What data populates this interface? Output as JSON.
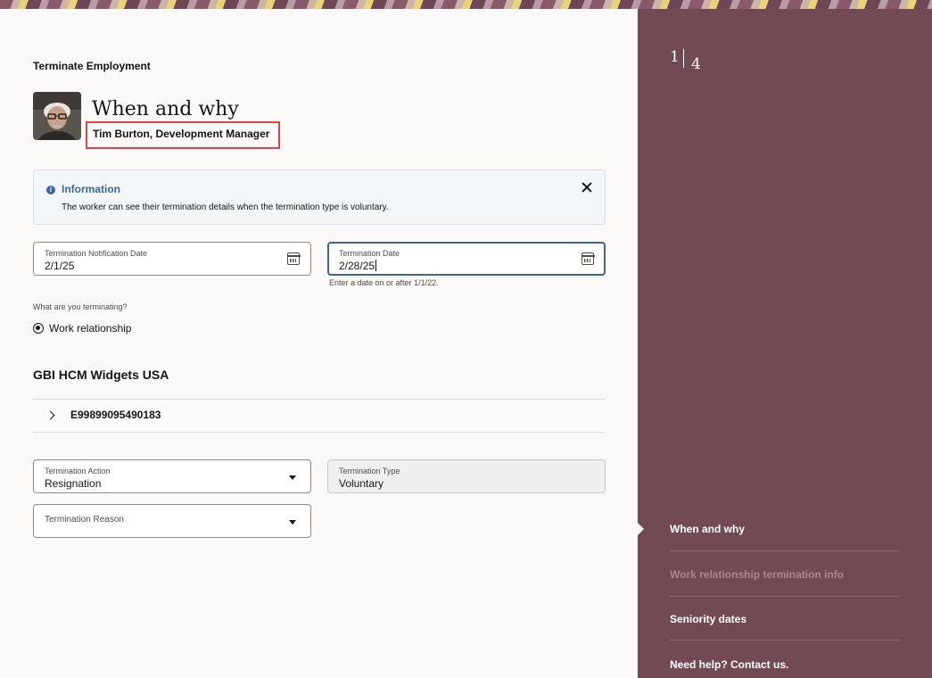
{
  "header": {
    "title": "Terminate Employment",
    "step_heading": "When and why",
    "person": "Tim Burton, Development Manager"
  },
  "info_message": {
    "title": "Information",
    "text": "The worker can see their termination details when the termination type is voluntary."
  },
  "dates": {
    "notification_label": "Termination Notification Date",
    "notification_value": "2/1/25",
    "termination_label": "Termination Date",
    "termination_value": "2/28/25",
    "termination_hint": "Enter a date on or after 1/1/22."
  },
  "terminating": {
    "question": "What are you terminating?",
    "selected_option": "Work relationship"
  },
  "legal_employer": {
    "name": "GBI HCM Widgets USA",
    "assignment_number": "E99899095490183"
  },
  "termination": {
    "action_label": "Termination Action",
    "action_value": "Resignation",
    "type_label": "Termination Type",
    "type_value": "Voluntary",
    "reason_label": "Termination Reason"
  },
  "sidebar": {
    "step_current": "1",
    "step_total": "4",
    "items": [
      {
        "label": "When and why",
        "state": "current"
      },
      {
        "label": "Work relationship termination info",
        "state": "disabled"
      },
      {
        "label": "Seniority dates",
        "state": "enabled"
      },
      {
        "label": "Need help? Contact us.",
        "state": "enabled"
      }
    ]
  },
  "colors": {
    "sidebar_bg": "#724a53",
    "info_accent": "#3e6691",
    "highlight_box": "#e0444a"
  }
}
